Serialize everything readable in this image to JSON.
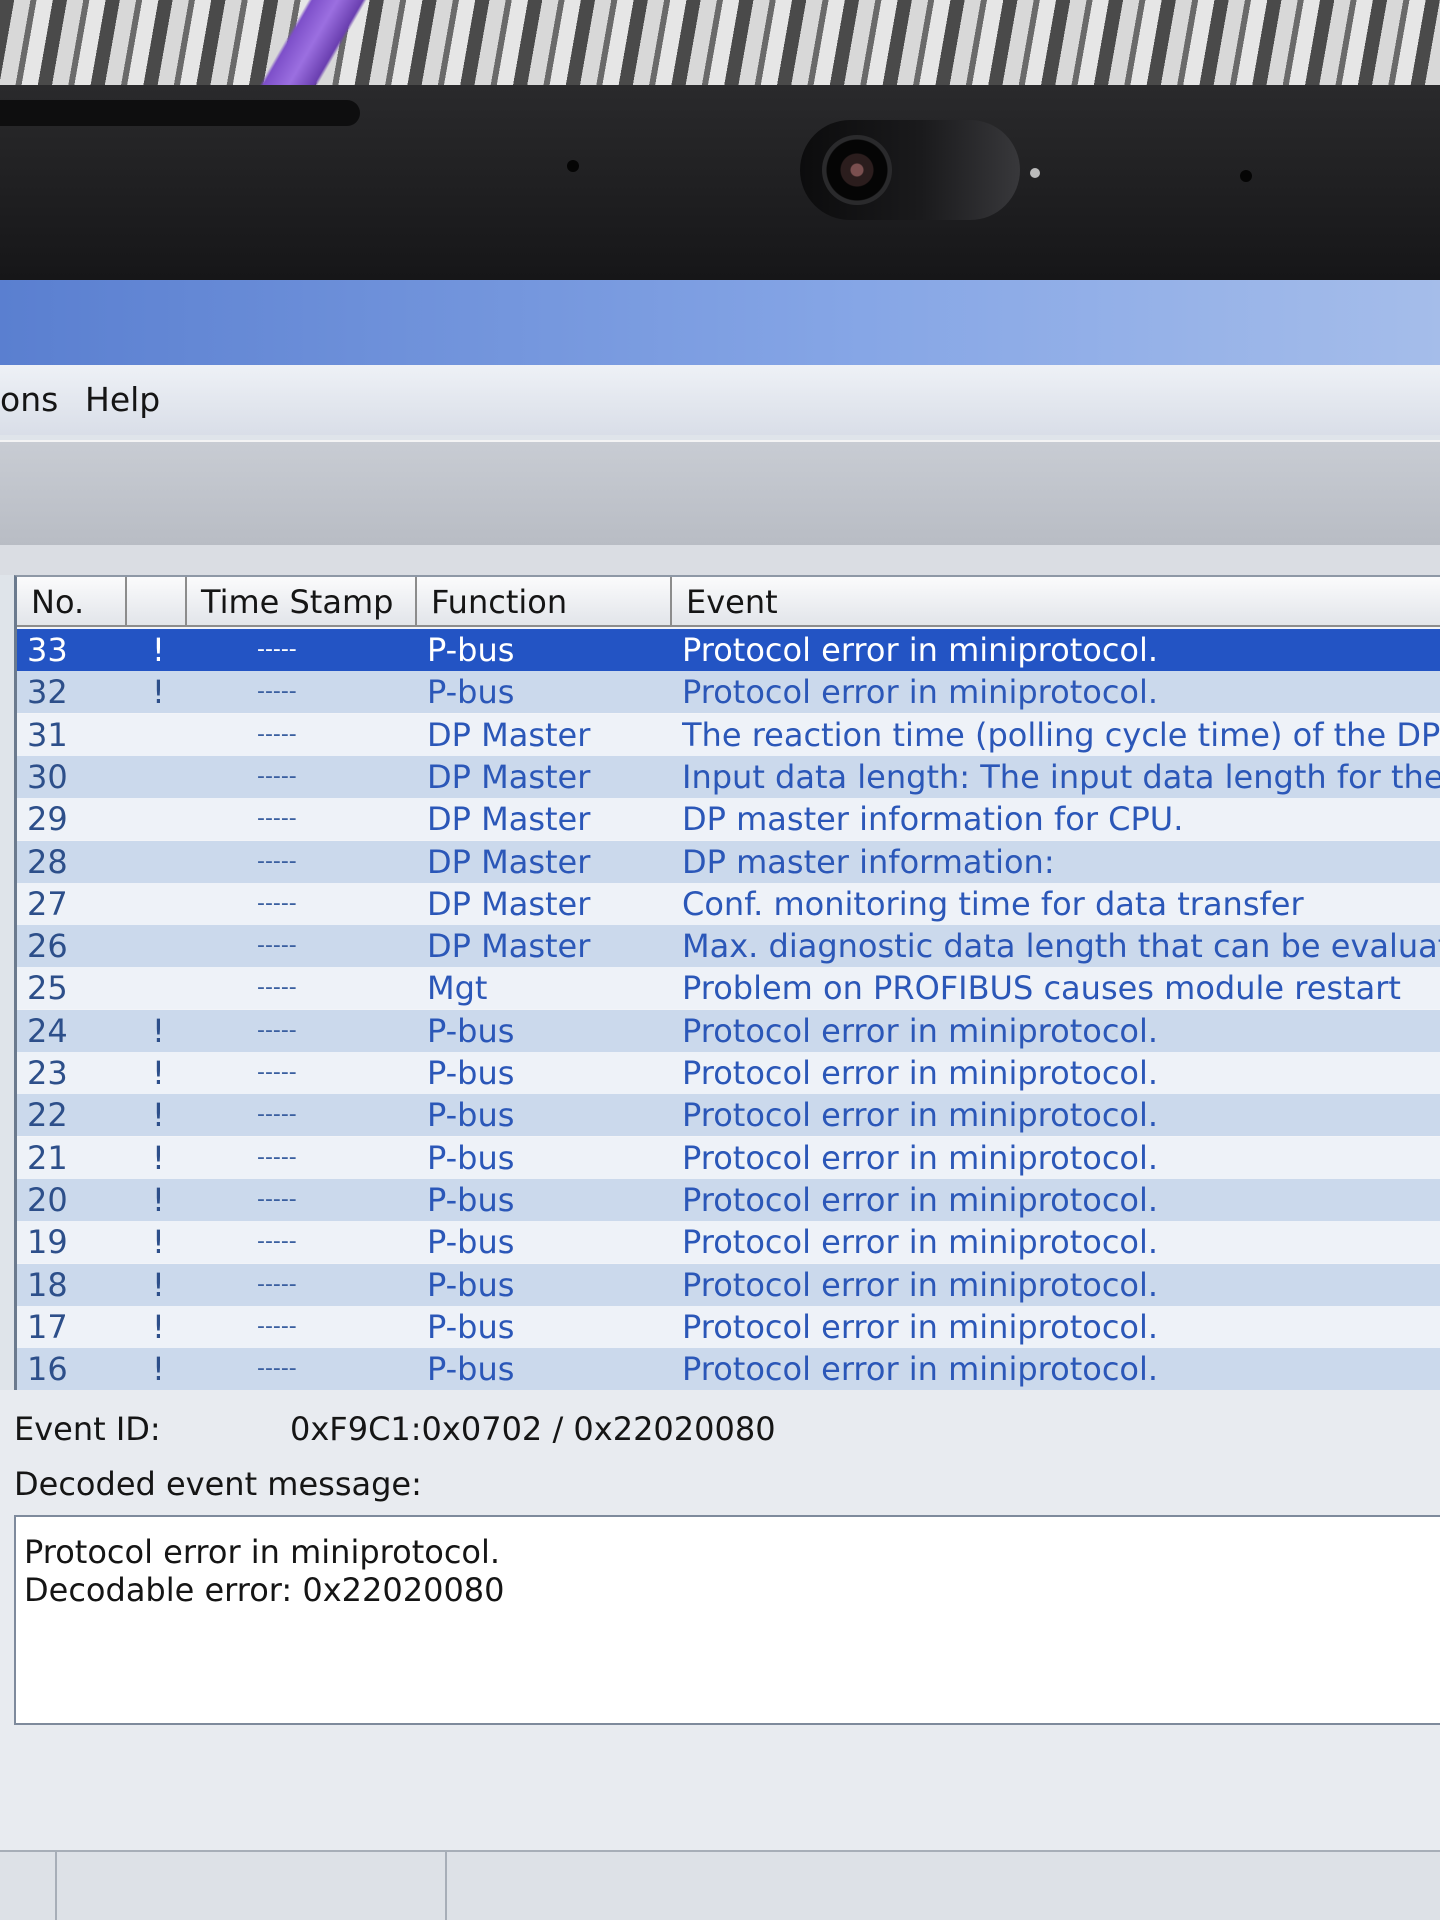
{
  "menu": {
    "items": [
      "ons",
      "Help"
    ]
  },
  "table": {
    "columns": [
      "No.",
      "",
      "Time Stamp",
      "Function",
      "Event"
    ],
    "rows": [
      {
        "no": "33",
        "flag": "!",
        "time": "-----",
        "function": "P-bus",
        "event": "Protocol error in miniprotocol."
      },
      {
        "no": "32",
        "flag": "!",
        "time": "-----",
        "function": "P-bus",
        "event": "Protocol error in miniprotocol."
      },
      {
        "no": "31",
        "flag": "",
        "time": "-----",
        "function": "DP Master",
        "event": "The reaction time (polling cycle time) of the DP maste"
      },
      {
        "no": "30",
        "flag": "",
        "time": "-----",
        "function": "DP Master",
        "event": "Input data length: The input data length for the DP_F"
      },
      {
        "no": "29",
        "flag": "",
        "time": "-----",
        "function": "DP Master",
        "event": "DP master information for CPU."
      },
      {
        "no": "28",
        "flag": "",
        "time": "-----",
        "function": "DP Master",
        "event": "DP master information:"
      },
      {
        "no": "27",
        "flag": "",
        "time": "-----",
        "function": "DP Master",
        "event": "Conf. monitoring time for data transfer"
      },
      {
        "no": "26",
        "flag": "",
        "time": "-----",
        "function": "DP Master",
        "event": "Max. diagnostic data length that can be evaluated:"
      },
      {
        "no": "25",
        "flag": "",
        "time": "-----",
        "function": "Mgt",
        "event": "Problem on PROFIBUS causes module restart"
      },
      {
        "no": "24",
        "flag": "!",
        "time": "-----",
        "function": "P-bus",
        "event": "Protocol error in miniprotocol."
      },
      {
        "no": "23",
        "flag": "!",
        "time": "-----",
        "function": "P-bus",
        "event": "Protocol error in miniprotocol."
      },
      {
        "no": "22",
        "flag": "!",
        "time": "-----",
        "function": "P-bus",
        "event": "Protocol error in miniprotocol."
      },
      {
        "no": "21",
        "flag": "!",
        "time": "-----",
        "function": "P-bus",
        "event": "Protocol error in miniprotocol."
      },
      {
        "no": "20",
        "flag": "!",
        "time": "-----",
        "function": "P-bus",
        "event": "Protocol error in miniprotocol."
      },
      {
        "no": "19",
        "flag": "!",
        "time": "-----",
        "function": "P-bus",
        "event": "Protocol error in miniprotocol."
      },
      {
        "no": "18",
        "flag": "!",
        "time": "-----",
        "function": "P-bus",
        "event": "Protocol error in miniprotocol."
      },
      {
        "no": "17",
        "flag": "!",
        "time": "-----",
        "function": "P-bus",
        "event": "Protocol error in miniprotocol."
      },
      {
        "no": "16",
        "flag": "!",
        "time": "-----",
        "function": "P-bus",
        "event": "Protocol error in miniprotocol."
      }
    ]
  },
  "details": {
    "event_id_label": "Event ID:",
    "event_id_value": "0xF9C1:0x0702 / 0x22020080",
    "decoded_label": "Decoded event message:",
    "message_lines": [
      "Protocol error in miniprotocol.",
      "Decodable error: 0x22020080"
    ]
  },
  "colors": {
    "selection": "#2354c4",
    "row_alt": "#cbd9ec",
    "row_plain": "#eef2f8",
    "event_text": "#2b57b8"
  }
}
